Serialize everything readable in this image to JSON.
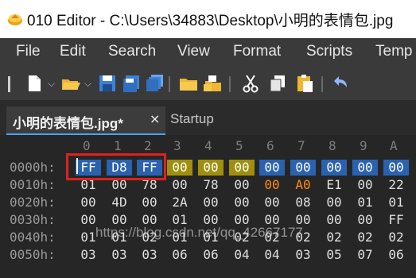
{
  "window": {
    "title": "010 Editor - C:\\Users\\34883\\Desktop\\小明的表情包.jpg",
    "icons": {
      "app": "010-editor-icon"
    }
  },
  "menu": {
    "items": [
      "File",
      "Edit",
      "Search",
      "View",
      "Format",
      "Scripts",
      "Temp"
    ]
  },
  "toolbar": {
    "icons": [
      "new-file-icon",
      "open-folder-icon",
      "save-icon",
      "save-as-icon",
      "save-all-icon",
      "folder-icon",
      "workspace-icon",
      "cut-icon",
      "copy-icon",
      "paste-icon"
    ]
  },
  "tabs": [
    {
      "label": "小明的表情包.jpg*",
      "active": true,
      "close": "×"
    },
    {
      "label": "Startup",
      "active": false
    }
  ],
  "hex": {
    "column_headers": [
      "0",
      "1",
      "2",
      "3",
      "4",
      "5",
      "6",
      "7",
      "8",
      "9",
      "A"
    ],
    "rows": [
      {
        "addr": "0000h:",
        "bytes": [
          "FF",
          "D8",
          "FF",
          "00",
          "00",
          "00",
          "00",
          "00",
          "00",
          "00",
          "00"
        ]
      },
      {
        "addr": "0010h:",
        "bytes": [
          "01",
          "00",
          "78",
          "00",
          "78",
          "00",
          "00",
          "A0",
          "E1",
          "00",
          "22"
        ]
      },
      {
        "addr": "0020h:",
        "bytes": [
          "00",
          "4D",
          "00",
          "2A",
          "00",
          "00",
          "00",
          "08",
          "00",
          "01",
          "01"
        ]
      },
      {
        "addr": "0030h:",
        "bytes": [
          "00",
          "00",
          "00",
          "01",
          "00",
          "00",
          "00",
          "00",
          "00",
          "00",
          "FF"
        ]
      },
      {
        "addr": "0040h:",
        "bytes": [
          "01",
          "01",
          "02",
          "01",
          "01",
          "02",
          "02",
          "02",
          "02",
          "02",
          "02"
        ]
      },
      {
        "addr": "0050h:",
        "bytes": [
          "03",
          "03",
          "03",
          "06",
          "06",
          "04",
          "04",
          "03",
          "05",
          "07",
          "06"
        ]
      }
    ],
    "highlight_colors": {
      "gold": "#a08f0d",
      "blue": "#2a62b0",
      "orange": "#ff8c1a",
      "cursor_box": "#e02020"
    }
  },
  "watermark": "https://blog.csdn.net/qq_42667177"
}
